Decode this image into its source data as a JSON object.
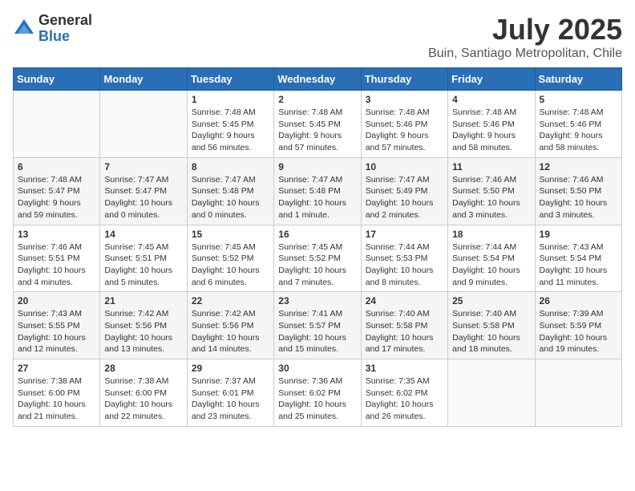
{
  "logo": {
    "general": "General",
    "blue": "Blue"
  },
  "header": {
    "month": "July 2025",
    "location": "Buin, Santiago Metropolitan, Chile"
  },
  "weekdays": [
    "Sunday",
    "Monday",
    "Tuesday",
    "Wednesday",
    "Thursday",
    "Friday",
    "Saturday"
  ],
  "weeks": [
    [
      {
        "day": "",
        "sunrise": "",
        "sunset": "",
        "daylight": ""
      },
      {
        "day": "",
        "sunrise": "",
        "sunset": "",
        "daylight": ""
      },
      {
        "day": "1",
        "sunrise": "Sunrise: 7:48 AM",
        "sunset": "Sunset: 5:45 PM",
        "daylight": "Daylight: 9 hours and 56 minutes."
      },
      {
        "day": "2",
        "sunrise": "Sunrise: 7:48 AM",
        "sunset": "Sunset: 5:45 PM",
        "daylight": "Daylight: 9 hours and 57 minutes."
      },
      {
        "day": "3",
        "sunrise": "Sunrise: 7:48 AM",
        "sunset": "Sunset: 5:46 PM",
        "daylight": "Daylight: 9 hours and 57 minutes."
      },
      {
        "day": "4",
        "sunrise": "Sunrise: 7:48 AM",
        "sunset": "Sunset: 5:46 PM",
        "daylight": "Daylight: 9 hours and 58 minutes."
      },
      {
        "day": "5",
        "sunrise": "Sunrise: 7:48 AM",
        "sunset": "Sunset: 5:46 PM",
        "daylight": "Daylight: 9 hours and 58 minutes."
      }
    ],
    [
      {
        "day": "6",
        "sunrise": "Sunrise: 7:48 AM",
        "sunset": "Sunset: 5:47 PM",
        "daylight": "Daylight: 9 hours and 59 minutes."
      },
      {
        "day": "7",
        "sunrise": "Sunrise: 7:47 AM",
        "sunset": "Sunset: 5:47 PM",
        "daylight": "Daylight: 10 hours and 0 minutes."
      },
      {
        "day": "8",
        "sunrise": "Sunrise: 7:47 AM",
        "sunset": "Sunset: 5:48 PM",
        "daylight": "Daylight: 10 hours and 0 minutes."
      },
      {
        "day": "9",
        "sunrise": "Sunrise: 7:47 AM",
        "sunset": "Sunset: 5:48 PM",
        "daylight": "Daylight: 10 hours and 1 minute."
      },
      {
        "day": "10",
        "sunrise": "Sunrise: 7:47 AM",
        "sunset": "Sunset: 5:49 PM",
        "daylight": "Daylight: 10 hours and 2 minutes."
      },
      {
        "day": "11",
        "sunrise": "Sunrise: 7:46 AM",
        "sunset": "Sunset: 5:50 PM",
        "daylight": "Daylight: 10 hours and 3 minutes."
      },
      {
        "day": "12",
        "sunrise": "Sunrise: 7:46 AM",
        "sunset": "Sunset: 5:50 PM",
        "daylight": "Daylight: 10 hours and 3 minutes."
      }
    ],
    [
      {
        "day": "13",
        "sunrise": "Sunrise: 7:46 AM",
        "sunset": "Sunset: 5:51 PM",
        "daylight": "Daylight: 10 hours and 4 minutes."
      },
      {
        "day": "14",
        "sunrise": "Sunrise: 7:45 AM",
        "sunset": "Sunset: 5:51 PM",
        "daylight": "Daylight: 10 hours and 5 minutes."
      },
      {
        "day": "15",
        "sunrise": "Sunrise: 7:45 AM",
        "sunset": "Sunset: 5:52 PM",
        "daylight": "Daylight: 10 hours and 6 minutes."
      },
      {
        "day": "16",
        "sunrise": "Sunrise: 7:45 AM",
        "sunset": "Sunset: 5:52 PM",
        "daylight": "Daylight: 10 hours and 7 minutes."
      },
      {
        "day": "17",
        "sunrise": "Sunrise: 7:44 AM",
        "sunset": "Sunset: 5:53 PM",
        "daylight": "Daylight: 10 hours and 8 minutes."
      },
      {
        "day": "18",
        "sunrise": "Sunrise: 7:44 AM",
        "sunset": "Sunset: 5:54 PM",
        "daylight": "Daylight: 10 hours and 9 minutes."
      },
      {
        "day": "19",
        "sunrise": "Sunrise: 7:43 AM",
        "sunset": "Sunset: 5:54 PM",
        "daylight": "Daylight: 10 hours and 11 minutes."
      }
    ],
    [
      {
        "day": "20",
        "sunrise": "Sunrise: 7:43 AM",
        "sunset": "Sunset: 5:55 PM",
        "daylight": "Daylight: 10 hours and 12 minutes."
      },
      {
        "day": "21",
        "sunrise": "Sunrise: 7:42 AM",
        "sunset": "Sunset: 5:56 PM",
        "daylight": "Daylight: 10 hours and 13 minutes."
      },
      {
        "day": "22",
        "sunrise": "Sunrise: 7:42 AM",
        "sunset": "Sunset: 5:56 PM",
        "daylight": "Daylight: 10 hours and 14 minutes."
      },
      {
        "day": "23",
        "sunrise": "Sunrise: 7:41 AM",
        "sunset": "Sunset: 5:57 PM",
        "daylight": "Daylight: 10 hours and 15 minutes."
      },
      {
        "day": "24",
        "sunrise": "Sunrise: 7:40 AM",
        "sunset": "Sunset: 5:58 PM",
        "daylight": "Daylight: 10 hours and 17 minutes."
      },
      {
        "day": "25",
        "sunrise": "Sunrise: 7:40 AM",
        "sunset": "Sunset: 5:58 PM",
        "daylight": "Daylight: 10 hours and 18 minutes."
      },
      {
        "day": "26",
        "sunrise": "Sunrise: 7:39 AM",
        "sunset": "Sunset: 5:59 PM",
        "daylight": "Daylight: 10 hours and 19 minutes."
      }
    ],
    [
      {
        "day": "27",
        "sunrise": "Sunrise: 7:38 AM",
        "sunset": "Sunset: 6:00 PM",
        "daylight": "Daylight: 10 hours and 21 minutes."
      },
      {
        "day": "28",
        "sunrise": "Sunrise: 7:38 AM",
        "sunset": "Sunset: 6:00 PM",
        "daylight": "Daylight: 10 hours and 22 minutes."
      },
      {
        "day": "29",
        "sunrise": "Sunrise: 7:37 AM",
        "sunset": "Sunset: 6:01 PM",
        "daylight": "Daylight: 10 hours and 23 minutes."
      },
      {
        "day": "30",
        "sunrise": "Sunrise: 7:36 AM",
        "sunset": "Sunset: 6:02 PM",
        "daylight": "Daylight: 10 hours and 25 minutes."
      },
      {
        "day": "31",
        "sunrise": "Sunrise: 7:35 AM",
        "sunset": "Sunset: 6:02 PM",
        "daylight": "Daylight: 10 hours and 26 minutes."
      },
      {
        "day": "",
        "sunrise": "",
        "sunset": "",
        "daylight": ""
      },
      {
        "day": "",
        "sunrise": "",
        "sunset": "",
        "daylight": ""
      }
    ]
  ]
}
